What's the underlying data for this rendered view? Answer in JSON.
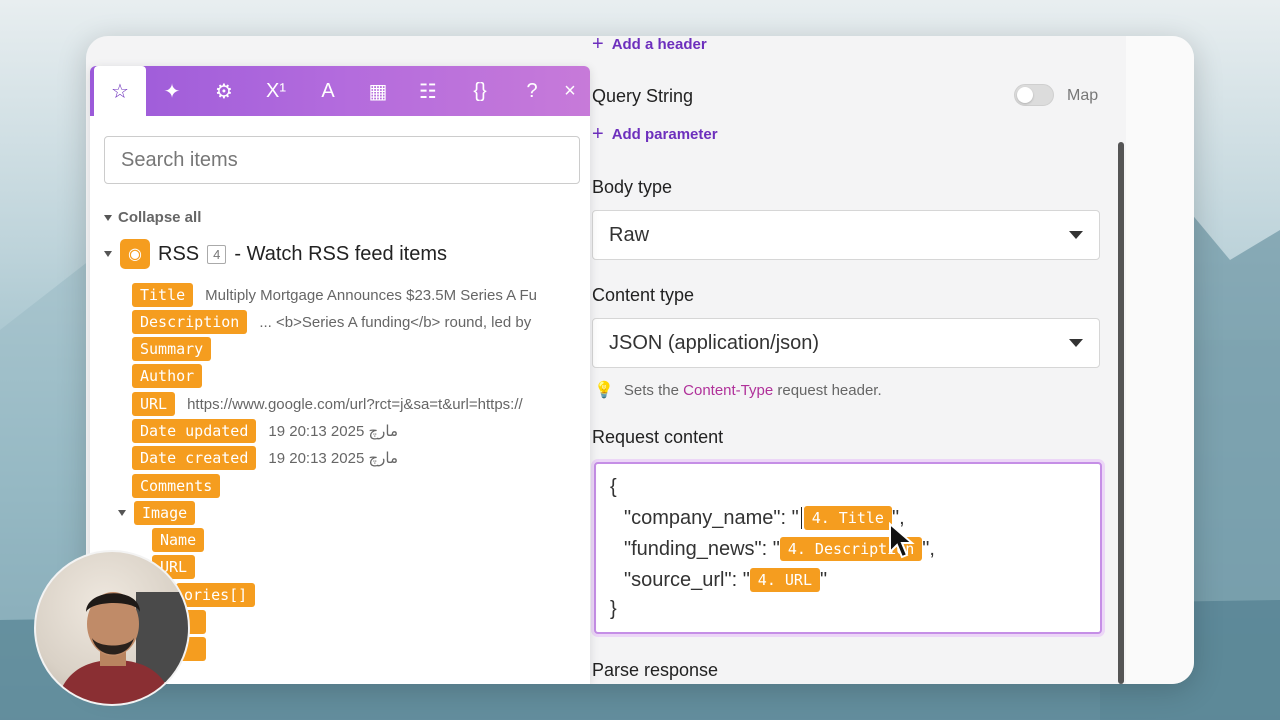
{
  "settings": {
    "add_header": "Add a header",
    "query_string_label": "Query String",
    "map_label": "Map",
    "add_parameter": "Add parameter",
    "body_type_label": "Body type",
    "body_type_value": "Raw",
    "content_type_label": "Content type",
    "content_type_value": "JSON (application/json)",
    "hint_prefix": "Sets the",
    "hint_accent": "Content-Type",
    "hint_suffix": "request header.",
    "request_content_label": "Request content",
    "parse_response_label": "Parse response",
    "code": {
      "open": "{",
      "line1_key": "\"company_name\": \"",
      "line1_pill": "4. Title",
      "line1_end": "\",",
      "line2_key": "\"funding_news\": \"",
      "line2_pill": "4. Description",
      "line2_end": "\",",
      "line3_key": "\"source_url\": \"",
      "line3_pill": "4. URL",
      "line3_end": "\"",
      "close": "}"
    }
  },
  "mapper": {
    "tools": [
      "☆",
      "✦",
      "⚙",
      "X¹",
      "A",
      "▦",
      "☷",
      "{}",
      "?",
      "×"
    ],
    "search_placeholder": "Search items",
    "collapse_all": "Collapse all",
    "module_name": "RSS",
    "module_number": "4",
    "module_desc": "- Watch RSS feed items",
    "items": [
      {
        "label": "Title",
        "value": "Multiply Mortgage Announces $23.5M Series A Fu"
      },
      {
        "label": "Description",
        "value": "... <b>Series A funding</b> round, led by"
      },
      {
        "label": "Summary",
        "value": ""
      },
      {
        "label": "Author",
        "value": ""
      },
      {
        "label": "URL",
        "value": "https://www.google.com/url?rct=j&sa=t&url=https://"
      },
      {
        "label": "Date updated",
        "value": "19 20:13 2025 مارچ"
      },
      {
        "label": "Date created",
        "value": "19 20:13 2025 مارچ"
      },
      {
        "label": "Comments",
        "value": ""
      }
    ],
    "image_label": "Image",
    "image_children": [
      "Name",
      "URL"
    ],
    "categories_label": "ories[]"
  },
  "colors": {
    "accent": "#6d2fbd",
    "pill": "#f59d1f",
    "toolbar": "#b36bdd"
  }
}
